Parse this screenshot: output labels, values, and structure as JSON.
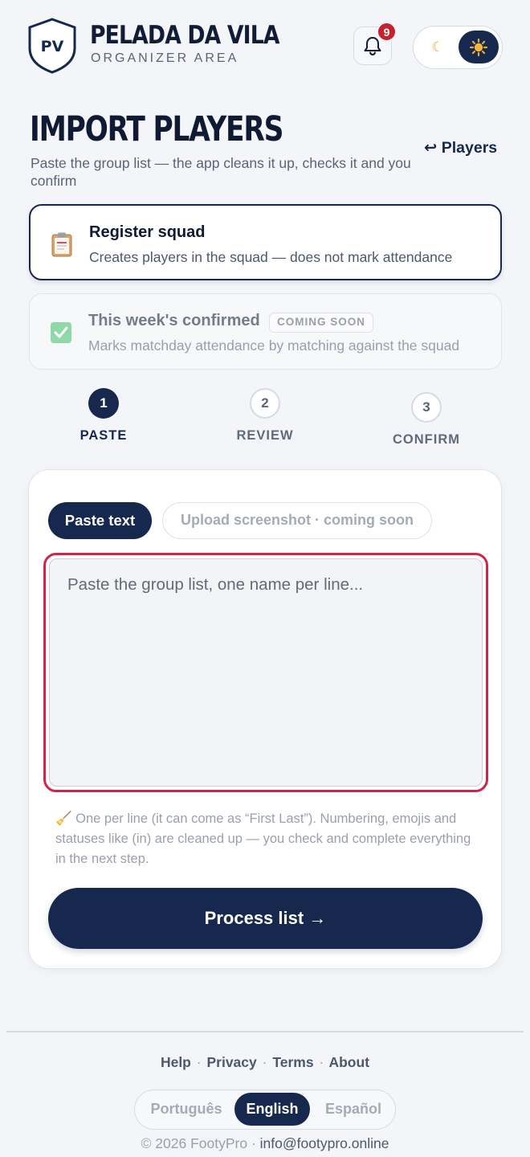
{
  "header": {
    "logo_text": "PV",
    "brand_title": "PELADA DA VILA",
    "brand_subtitle": "ORGANIZER AREA",
    "notifications_count": "9",
    "theme_icons": {
      "light": "moon-icon",
      "dark": "sun-icon"
    }
  },
  "page": {
    "title": "IMPORT PLAYERS",
    "subtitle": "Paste the group list — the app cleans it up, checks it and you confirm",
    "back_link": "↩ Players"
  },
  "modes": [
    {
      "title": "Register squad",
      "description": "Creates players in the squad — does not mark attendance",
      "icon": "clipboard-icon",
      "selected": true
    },
    {
      "title": "This week's confirmed",
      "badge": "COMING SOON",
      "description": "Marks matchday attendance by matching against the squad",
      "icon": "checkbox-icon",
      "selected": false
    }
  ],
  "steps": [
    {
      "number": "1",
      "label": "PASTE",
      "active": true
    },
    {
      "number": "2",
      "label": "REVIEW",
      "active": false
    },
    {
      "number": "3",
      "label": "CONFIRM",
      "active": false
    }
  ],
  "input_tabs": {
    "paste": "Paste text",
    "upload": "Upload screenshot · coming soon"
  },
  "textarea": {
    "placeholder": "Paste the group list, one name per line...",
    "value": ""
  },
  "hint": "🧹 One per line (it can come as “First Last”). Numbering, emojis and statuses like (in) are cleaned up — you check and complete everything in the next step.",
  "process_button": "Process list →",
  "footer": {
    "links": [
      "Help",
      "Privacy",
      "Terms",
      "About"
    ],
    "separator": "·",
    "languages": [
      "Português",
      "English",
      "Español"
    ],
    "selected_language": "English",
    "copyright": "© 2026 FootyPro ·",
    "email": "info@footypro.online"
  },
  "colors": {
    "primary": "#16284d",
    "badge": "#c5212f",
    "focus_outline": "#d2234b",
    "background": "#f3f5f8"
  }
}
